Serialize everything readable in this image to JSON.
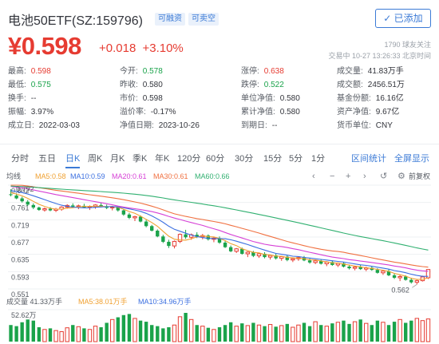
{
  "header": {
    "name": "电池50ETF(SZ:159796)",
    "badge_margin": "可融资",
    "badge_short": "可卖空",
    "added_label": "✓ 已添加"
  },
  "price": {
    "current": "¥0.598",
    "change": "+0.018",
    "change_pct": "+3.10%",
    "followers": "1790 球友关注",
    "trade_time": "交易中 10-27 13:26:33 北京时间"
  },
  "quote": {
    "rows": [
      [
        {
          "label": "最高:",
          "value": "0.598",
          "tone": "up"
        },
        {
          "label": "今开:",
          "value": "0.578",
          "tone": "down"
        },
        {
          "label": "涨停:",
          "value": "0.638",
          "tone": "up"
        },
        {
          "label": "成交量:",
          "value": "41.83万手",
          "tone": ""
        }
      ],
      [
        {
          "label": "最低:",
          "value": "0.575",
          "tone": "down"
        },
        {
          "label": "昨收:",
          "value": "0.580",
          "tone": ""
        },
        {
          "label": "跌停:",
          "value": "0.522",
          "tone": "down"
        },
        {
          "label": "成交额:",
          "value": "2456.51万",
          "tone": ""
        }
      ],
      [
        {
          "label": "换手:",
          "value": "--",
          "tone": ""
        },
        {
          "label": "市价:",
          "value": "0.598",
          "tone": ""
        },
        {
          "label": "单位净值:",
          "value": "0.580",
          "tone": ""
        },
        {
          "label": "基金份额:",
          "value": "16.16亿",
          "tone": ""
        }
      ],
      [
        {
          "label": "振幅:",
          "value": "3.97%",
          "tone": ""
        },
        {
          "label": "溢价率:",
          "value": "-0.17%",
          "tone": ""
        },
        {
          "label": "累计净值:",
          "value": "0.580",
          "tone": ""
        },
        {
          "label": "资产净值:",
          "value": "9.67亿",
          "tone": ""
        }
      ],
      [
        {
          "label": "成立日:",
          "value": "2022-03-03",
          "tone": ""
        },
        {
          "label": "净值日期:",
          "value": "2023-10-26",
          "tone": ""
        },
        {
          "label": "到期日:",
          "value": "--",
          "tone": ""
        },
        {
          "label": "货币单位:",
          "value": "CNY",
          "tone": ""
        }
      ]
    ]
  },
  "periods": [
    "分时",
    "五日",
    "日K",
    "周K",
    "月K",
    "季K",
    "年K",
    "120分",
    "60分",
    "30分",
    "15分",
    "5分",
    "1分"
  ],
  "active_period": "日K",
  "links": {
    "stats": "区间统计",
    "fullscreen": "全屏显示"
  },
  "ma": {
    "label": "均线",
    "items": [
      {
        "text": "MA5:0.58",
        "color": "#f0a030"
      },
      {
        "text": "MA10:0.59",
        "color": "#3b6fe0"
      },
      {
        "text": "MA20:0.61",
        "color": "#d640d6"
      },
      {
        "text": "MA30:0.61",
        "color": "#f07040"
      },
      {
        "text": "MA60:0.66",
        "color": "#30b070"
      }
    ],
    "adjust": "前复权"
  },
  "volume": {
    "label": "成交量 41.33万手",
    "ma5": "MA5:38.01万手",
    "ma10": "MA10:34.96万手",
    "ma5_color": "#f0a030",
    "ma10_color": "#3b6fe0",
    "max_label": "52.62万"
  },
  "colors": {
    "up": "#e63b31",
    "down": "#1aa34a",
    "accent": "#3b7ad6"
  },
  "chart_data": {
    "type": "candlestick",
    "y_ticks": [
      "0.802",
      "0.761",
      "0.719",
      "0.677",
      "0.635",
      "0.593",
      "0.551"
    ],
    "ylim": [
      0.551,
      0.802
    ],
    "high_label": "0.792",
    "low_label": "0.562",
    "candles": [
      {
        "o": 0.78,
        "h": 0.792,
        "l": 0.775,
        "c": 0.778
      },
      {
        "o": 0.777,
        "h": 0.782,
        "l": 0.768,
        "c": 0.77
      },
      {
        "o": 0.77,
        "h": 0.774,
        "l": 0.76,
        "c": 0.763
      },
      {
        "o": 0.762,
        "h": 0.766,
        "l": 0.752,
        "c": 0.755
      },
      {
        "o": 0.754,
        "h": 0.758,
        "l": 0.744,
        "c": 0.748
      },
      {
        "o": 0.748,
        "h": 0.75,
        "l": 0.74,
        "c": 0.742
      },
      {
        "o": 0.742,
        "h": 0.748,
        "l": 0.738,
        "c": 0.745
      },
      {
        "o": 0.745,
        "h": 0.749,
        "l": 0.739,
        "c": 0.741
      },
      {
        "o": 0.741,
        "h": 0.747,
        "l": 0.737,
        "c": 0.744
      },
      {
        "o": 0.744,
        "h": 0.751,
        "l": 0.74,
        "c": 0.749
      },
      {
        "o": 0.749,
        "h": 0.756,
        "l": 0.745,
        "c": 0.753
      },
      {
        "o": 0.753,
        "h": 0.758,
        "l": 0.747,
        "c": 0.75
      },
      {
        "o": 0.75,
        "h": 0.755,
        "l": 0.744,
        "c": 0.752
      },
      {
        "o": 0.752,
        "h": 0.757,
        "l": 0.746,
        "c": 0.748
      },
      {
        "o": 0.748,
        "h": 0.753,
        "l": 0.742,
        "c": 0.75
      },
      {
        "o": 0.75,
        "h": 0.756,
        "l": 0.745,
        "c": 0.754
      },
      {
        "o": 0.754,
        "h": 0.759,
        "l": 0.748,
        "c": 0.751
      },
      {
        "o": 0.751,
        "h": 0.755,
        "l": 0.744,
        "c": 0.747
      },
      {
        "o": 0.747,
        "h": 0.752,
        "l": 0.741,
        "c": 0.749
      },
      {
        "o": 0.749,
        "h": 0.752,
        "l": 0.738,
        "c": 0.741
      },
      {
        "o": 0.741,
        "h": 0.744,
        "l": 0.728,
        "c": 0.731
      },
      {
        "o": 0.731,
        "h": 0.735,
        "l": 0.72,
        "c": 0.723
      },
      {
        "o": 0.723,
        "h": 0.728,
        "l": 0.715,
        "c": 0.726
      },
      {
        "o": 0.726,
        "h": 0.729,
        "l": 0.712,
        "c": 0.714
      },
      {
        "o": 0.714,
        "h": 0.718,
        "l": 0.7,
        "c": 0.703
      },
      {
        "o": 0.703,
        "h": 0.706,
        "l": 0.69,
        "c": 0.692
      },
      {
        "o": 0.692,
        "h": 0.695,
        "l": 0.676,
        "c": 0.678
      },
      {
        "o": 0.678,
        "h": 0.682,
        "l": 0.662,
        "c": 0.665
      },
      {
        "o": 0.665,
        "h": 0.67,
        "l": 0.65,
        "c": 0.655
      },
      {
        "o": 0.655,
        "h": 0.668,
        "l": 0.649,
        "c": 0.666
      },
      {
        "o": 0.666,
        "h": 0.685,
        "l": 0.662,
        "c": 0.683
      },
      {
        "o": 0.683,
        "h": 0.694,
        "l": 0.672,
        "c": 0.676
      },
      {
        "o": 0.676,
        "h": 0.685,
        "l": 0.67,
        "c": 0.682
      },
      {
        "o": 0.682,
        "h": 0.688,
        "l": 0.674,
        "c": 0.677
      },
      {
        "o": 0.677,
        "h": 0.684,
        "l": 0.671,
        "c": 0.68
      },
      {
        "o": 0.68,
        "h": 0.683,
        "l": 0.668,
        "c": 0.671
      },
      {
        "o": 0.671,
        "h": 0.677,
        "l": 0.664,
        "c": 0.674
      },
      {
        "o": 0.674,
        "h": 0.678,
        "l": 0.66,
        "c": 0.663
      },
      {
        "o": 0.663,
        "h": 0.667,
        "l": 0.65,
        "c": 0.652
      },
      {
        "o": 0.652,
        "h": 0.656,
        "l": 0.64,
        "c": 0.642
      },
      {
        "o": 0.642,
        "h": 0.65,
        "l": 0.638,
        "c": 0.648
      },
      {
        "o": 0.648,
        "h": 0.651,
        "l": 0.634,
        "c": 0.636
      },
      {
        "o": 0.636,
        "h": 0.642,
        "l": 0.628,
        "c": 0.64
      },
      {
        "o": 0.64,
        "h": 0.643,
        "l": 0.628,
        "c": 0.631
      },
      {
        "o": 0.631,
        "h": 0.638,
        "l": 0.626,
        "c": 0.636
      },
      {
        "o": 0.636,
        "h": 0.64,
        "l": 0.625,
        "c": 0.628
      },
      {
        "o": 0.628,
        "h": 0.634,
        "l": 0.622,
        "c": 0.632
      },
      {
        "o": 0.632,
        "h": 0.636,
        "l": 0.622,
        "c": 0.625
      },
      {
        "o": 0.625,
        "h": 0.631,
        "l": 0.619,
        "c": 0.629
      },
      {
        "o": 0.629,
        "h": 0.633,
        "l": 0.618,
        "c": 0.621
      },
      {
        "o": 0.621,
        "h": 0.627,
        "l": 0.616,
        "c": 0.624
      },
      {
        "o": 0.624,
        "h": 0.63,
        "l": 0.619,
        "c": 0.627
      },
      {
        "o": 0.627,
        "h": 0.631,
        "l": 0.618,
        "c": 0.62
      },
      {
        "o": 0.62,
        "h": 0.625,
        "l": 0.612,
        "c": 0.615
      },
      {
        "o": 0.615,
        "h": 0.622,
        "l": 0.611,
        "c": 0.619
      },
      {
        "o": 0.619,
        "h": 0.623,
        "l": 0.61,
        "c": 0.612
      },
      {
        "o": 0.612,
        "h": 0.618,
        "l": 0.606,
        "c": 0.616
      },
      {
        "o": 0.616,
        "h": 0.62,
        "l": 0.607,
        "c": 0.609
      },
      {
        "o": 0.609,
        "h": 0.615,
        "l": 0.604,
        "c": 0.613
      },
      {
        "o": 0.613,
        "h": 0.616,
        "l": 0.603,
        "c": 0.605
      },
      {
        "o": 0.605,
        "h": 0.61,
        "l": 0.598,
        "c": 0.601
      },
      {
        "o": 0.601,
        "h": 0.607,
        "l": 0.596,
        "c": 0.604
      },
      {
        "o": 0.604,
        "h": 0.609,
        "l": 0.597,
        "c": 0.599
      },
      {
        "o": 0.599,
        "h": 0.605,
        "l": 0.594,
        "c": 0.602
      },
      {
        "o": 0.602,
        "h": 0.607,
        "l": 0.595,
        "c": 0.597
      },
      {
        "o": 0.597,
        "h": 0.601,
        "l": 0.588,
        "c": 0.59
      },
      {
        "o": 0.59,
        "h": 0.596,
        "l": 0.585,
        "c": 0.594
      },
      {
        "o": 0.594,
        "h": 0.598,
        "l": 0.582,
        "c": 0.584
      },
      {
        "o": 0.584,
        "h": 0.589,
        "l": 0.575,
        "c": 0.578
      },
      {
        "o": 0.578,
        "h": 0.585,
        "l": 0.57,
        "c": 0.581
      },
      {
        "o": 0.581,
        "h": 0.584,
        "l": 0.571,
        "c": 0.573
      },
      {
        "o": 0.573,
        "h": 0.578,
        "l": 0.564,
        "c": 0.567
      },
      {
        "o": 0.567,
        "h": 0.574,
        "l": 0.562,
        "c": 0.571
      },
      {
        "o": 0.571,
        "h": 0.583,
        "l": 0.569,
        "c": 0.58
      },
      {
        "o": 0.578,
        "h": 0.598,
        "l": 0.575,
        "c": 0.598
      }
    ],
    "volumes": [
      30,
      28,
      35,
      40,
      38,
      26,
      22,
      24,
      20,
      18,
      25,
      30,
      27,
      24,
      22,
      28,
      26,
      34,
      40,
      44,
      48,
      50,
      42,
      38,
      36,
      30,
      28,
      24,
      26,
      30,
      45,
      52,
      40,
      30,
      28,
      25,
      22,
      26,
      30,
      35,
      28,
      33,
      29,
      34,
      30,
      28,
      31,
      27,
      29,
      32,
      26,
      30,
      34,
      28,
      36,
      30,
      28,
      33,
      35,
      38,
      32,
      36,
      40,
      33,
      30,
      38,
      35,
      30,
      36,
      40,
      34,
      38,
      42,
      38,
      41
    ]
  }
}
